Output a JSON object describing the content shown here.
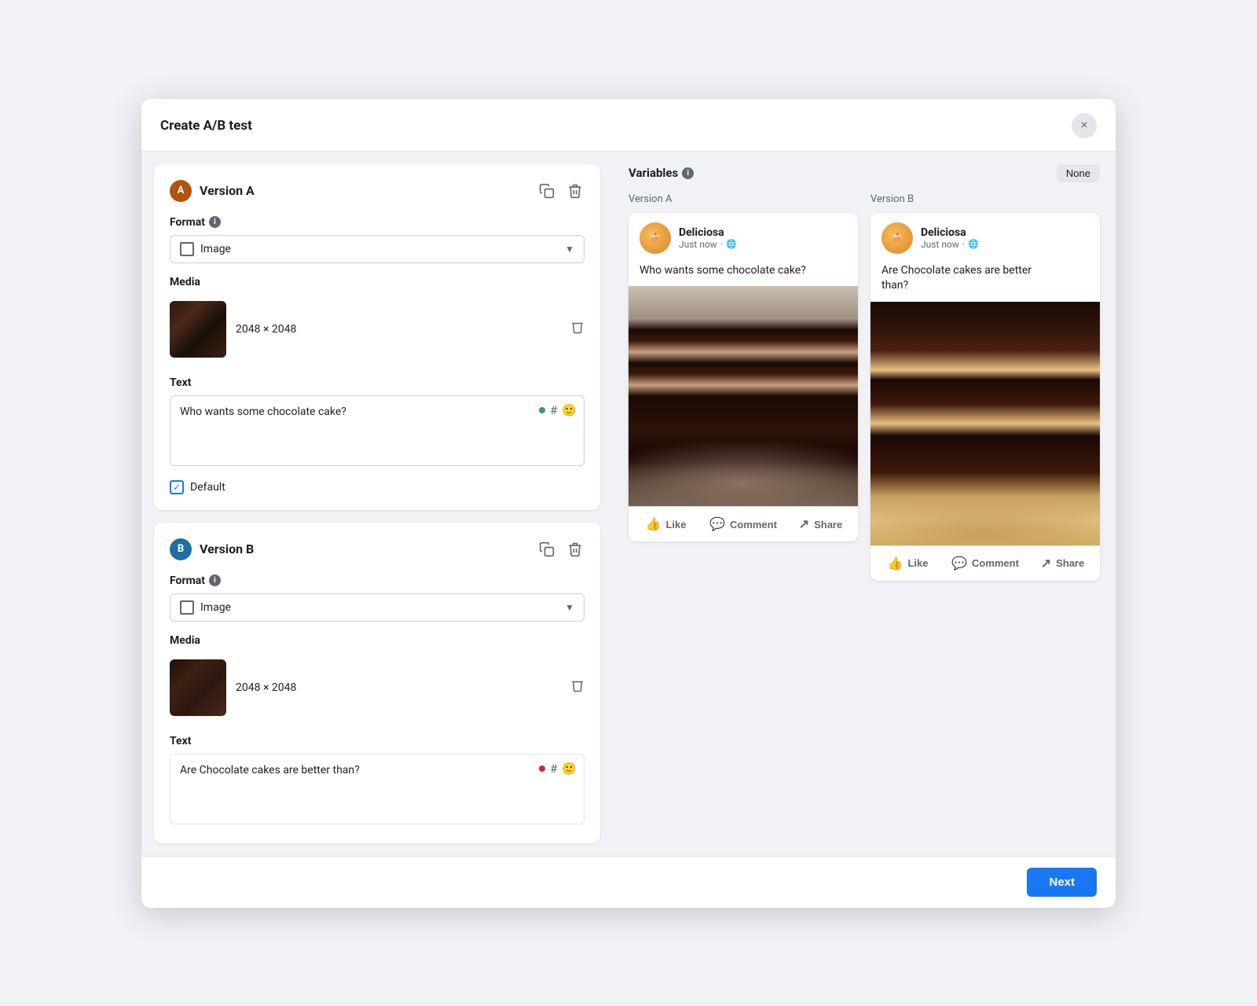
{
  "modal": {
    "title": "Create A/B test",
    "close_label": "×"
  },
  "footer": {
    "next_label": "Next"
  },
  "variables": {
    "title": "Variables",
    "none_label": "None"
  },
  "version_a": {
    "label": "Version A",
    "badge": "A",
    "format_label": "Format",
    "format_value": "Image",
    "media_label": "Media",
    "media_size": "2048 × 2048",
    "text_label": "Text",
    "text_value": "Who wants some chocolate cake?",
    "default_label": "Default",
    "preview_label": "Version A",
    "page_name": "Deliciosa",
    "post_time": "Just now",
    "like_label": "Like",
    "comment_label": "Comment",
    "share_label": "Share"
  },
  "version_b": {
    "label": "Version B",
    "badge": "B",
    "format_label": "Format",
    "format_value": "Image",
    "media_label": "Media",
    "media_size": "2048 × 2048",
    "text_label": "Text",
    "text_value": "Are Chocolate cakes are better than?",
    "preview_label": "Version B",
    "page_name": "Deliciosa",
    "post_time": "Just now",
    "post_text_a": "Are Chocolate cakes are better",
    "post_text_b": "than?",
    "like_label": "Like",
    "comment_label": "Comment",
    "share_label": "Share"
  }
}
